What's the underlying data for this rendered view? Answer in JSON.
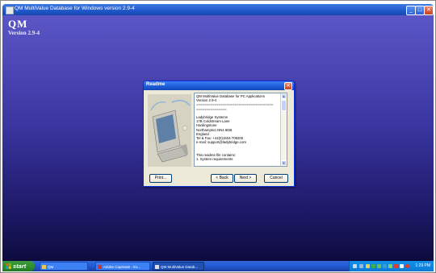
{
  "window": {
    "title": "QM MultiValue Database for Windows version 2.9-4",
    "minimize_glyph": "_",
    "restore_glyph": "□",
    "close_glyph": "✕"
  },
  "background": {
    "logo": "QM",
    "version": "Version 2.9-4"
  },
  "dialog": {
    "title": "Readme",
    "close_glyph": "✕",
    "readme_lines": [
      "QM MultiValue Database for PC Applications",
      "Version 2.9-4",
      "======================================",
      "===============",
      "",
      "Ladybridge Systems",
      "17B Coldstream Lane",
      "Hardingstone",
      "Northampton NN4 6DB",
      "England",
      "Tel & Fax: +44(0)1604-709200",
      "e-mail: support@ladybridge.com",
      "",
      "",
      "This readme file contains:",
      "  1. System requirements"
    ],
    "buttons": {
      "print": "Print...",
      "back": "< Back",
      "next": "Next >",
      "cancel": "Cancel"
    }
  },
  "taskbar": {
    "start_label": "start",
    "tasks": [
      {
        "label": "QM"
      },
      {
        "label": "Adobe Captivate - Ex..."
      },
      {
        "label": "QM MultiValue Datab..."
      }
    ],
    "clock": "1:29 PM"
  }
}
